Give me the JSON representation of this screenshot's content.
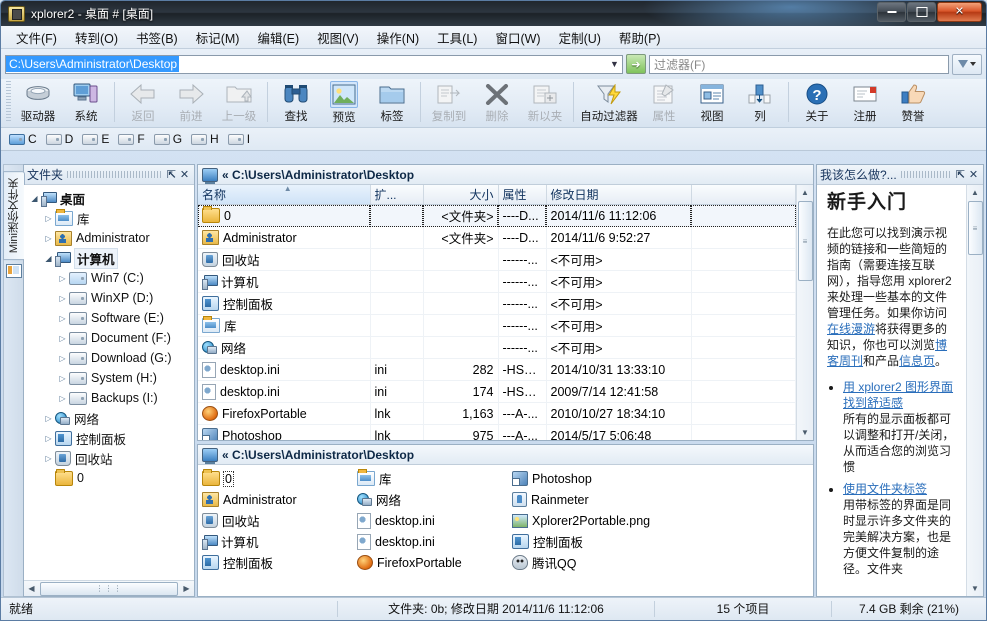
{
  "window": {
    "title": "xplorer2 - 桌面 # [桌面]",
    "minimize_label": "最小化",
    "maximize_label": "最大化",
    "close_label": "✕"
  },
  "menu": {
    "items": [
      "文件(F)",
      "转到(O)",
      "书签(B)",
      "标记(M)",
      "编辑(E)",
      "视图(V)",
      "操作(N)",
      "工具(L)",
      "窗口(W)",
      "定制(U)",
      "帮助(P)"
    ]
  },
  "address": {
    "value": "C:\\Users\\Administrator\\Desktop",
    "dropdown_glyph": "▼",
    "go_glyph": "➜",
    "filter_placeholder": "过滤器(F)",
    "filter_value": ""
  },
  "toolbar": {
    "buttons": [
      {
        "label": "驱动器",
        "icon": "drive-icon",
        "state": "normal"
      },
      {
        "label": "系统",
        "icon": "system-icon",
        "state": "normal"
      },
      {
        "label": "返回",
        "icon": "back-arrow-icon",
        "state": "disabled"
      },
      {
        "label": "前进",
        "icon": "forward-arrow-icon",
        "state": "disabled"
      },
      {
        "label": "上一级",
        "icon": "up-folder-icon",
        "state": "disabled"
      },
      {
        "label": "查找",
        "icon": "binoculars-icon",
        "state": "normal"
      },
      {
        "label": "预览",
        "icon": "preview-image-icon",
        "state": "selected"
      },
      {
        "label": "标签",
        "icon": "folder-tab-icon",
        "state": "normal"
      },
      {
        "label": "复制到",
        "icon": "copy-to-icon",
        "state": "disabled"
      },
      {
        "label": "删除",
        "icon": "delete-x-icon",
        "state": "disabled"
      },
      {
        "label": "新以夹",
        "icon": "new-folder-icon",
        "state": "disabled"
      },
      {
        "label": "自动过滤器",
        "icon": "auto-filter-icon",
        "state": "normal"
      },
      {
        "label": "属性",
        "icon": "properties-icon",
        "state": "disabled"
      },
      {
        "label": "视图",
        "icon": "view-icon",
        "state": "normal"
      },
      {
        "label": "列",
        "icon": "columns-icon",
        "state": "normal"
      },
      {
        "label": "关于",
        "icon": "about-question-icon",
        "state": "normal"
      },
      {
        "label": "注册",
        "icon": "register-envelope-icon",
        "state": "normal"
      },
      {
        "label": "赞誉",
        "icon": "thumbs-up-icon",
        "state": "normal"
      }
    ]
  },
  "drivebar": {
    "drives": [
      {
        "letter": "C",
        "icon": "system-drive-icon"
      },
      {
        "letter": "D",
        "icon": "drive-icon"
      },
      {
        "letter": "E",
        "icon": "drive-icon"
      },
      {
        "letter": "F",
        "icon": "drive-icon"
      },
      {
        "letter": "G",
        "icon": "drive-icon"
      },
      {
        "letter": "H",
        "icon": "drive-icon"
      },
      {
        "letter": "I",
        "icon": "drive-icon"
      }
    ]
  },
  "vertical_tab": {
    "label": "Mini迷你文件夹"
  },
  "tree_panel": {
    "title": "文件夹",
    "pin_glyph": "⇱",
    "close_glyph": "✕",
    "nodes": [
      {
        "label": "桌面",
        "indent": 0,
        "arrow": "open",
        "icon": "desktop-icon",
        "bold": true
      },
      {
        "label": "库",
        "indent": 1,
        "arrow": "closed",
        "icon": "library-icon",
        "bold": false
      },
      {
        "label": "Administrator",
        "indent": 1,
        "arrow": "closed",
        "icon": "user-folder-icon",
        "bold": false
      },
      {
        "label": "计算机",
        "indent": 1,
        "arrow": "open",
        "icon": "computer-icon",
        "bold": true,
        "highlight": true
      },
      {
        "label": "Win7 (C:)",
        "indent": 2,
        "arrow": "closed",
        "icon": "system-drive-icon",
        "bold": false
      },
      {
        "label": "WinXP (D:)",
        "indent": 2,
        "arrow": "closed",
        "icon": "drive-icon",
        "bold": false
      },
      {
        "label": "Software (E:)",
        "indent": 2,
        "arrow": "closed",
        "icon": "drive-icon",
        "bold": false
      },
      {
        "label": "Document (F:)",
        "indent": 2,
        "arrow": "closed",
        "icon": "drive-icon",
        "bold": false
      },
      {
        "label": "Download (G:)",
        "indent": 2,
        "arrow": "closed",
        "icon": "drive-icon",
        "bold": false
      },
      {
        "label": "System (H:)",
        "indent": 2,
        "arrow": "closed",
        "icon": "drive-icon",
        "bold": false
      },
      {
        "label": "Backups (I:)",
        "indent": 2,
        "arrow": "closed",
        "icon": "drive-icon",
        "bold": false
      },
      {
        "label": "网络",
        "indent": 1,
        "arrow": "closed",
        "icon": "network-icon",
        "bold": false
      },
      {
        "label": "控制面板",
        "indent": 1,
        "arrow": "closed",
        "icon": "control-panel-icon",
        "bold": false
      },
      {
        "label": "回收站",
        "indent": 1,
        "arrow": "closed",
        "icon": "recycle-bin-icon",
        "bold": false
      },
      {
        "label": "0",
        "indent": 1,
        "arrow": "none",
        "icon": "folder-icon",
        "bold": false
      }
    ],
    "hscroll": {
      "left_glyph": "◀",
      "right_glyph": "▶",
      "thumb_glyph": "⋮⋮⋮"
    }
  },
  "list_pane": {
    "tab_title": "« C:\\Users\\Administrator\\Desktop",
    "columns": [
      {
        "key": "name",
        "label": "名称",
        "align": "left",
        "sorted": true,
        "sort_glyph": "▲"
      },
      {
        "key": "ext",
        "label": "扩...",
        "align": "left"
      },
      {
        "key": "size",
        "label": "大小",
        "align": "right"
      },
      {
        "key": "attr",
        "label": "属性",
        "align": "left"
      },
      {
        "key": "date",
        "label": "修改日期",
        "align": "left"
      },
      {
        "key": "blank",
        "label": "",
        "align": "left"
      }
    ],
    "rows": [
      {
        "name": "0",
        "icon": "folder-icon",
        "ext": "",
        "size": "<文件夹>",
        "attr": "----D...",
        "date": "2014/11/6 11:12:06",
        "focused": true
      },
      {
        "name": "Administrator",
        "icon": "user-folder-icon",
        "ext": "",
        "size": "<文件夹>",
        "attr": "----D...",
        "date": "2014/11/6 9:52:27"
      },
      {
        "name": "回收站",
        "icon": "recycle-bin-icon",
        "ext": "",
        "size": "",
        "attr": "------...",
        "date": "<不可用>"
      },
      {
        "name": "计算机",
        "icon": "computer-icon",
        "ext": "",
        "size": "",
        "attr": "------...",
        "date": "<不可用>"
      },
      {
        "name": "控制面板",
        "icon": "control-panel-icon",
        "ext": "",
        "size": "",
        "attr": "------...",
        "date": "<不可用>"
      },
      {
        "name": "库",
        "icon": "library-icon",
        "ext": "",
        "size": "",
        "attr": "------...",
        "date": "<不可用>"
      },
      {
        "name": "网络",
        "icon": "network-icon",
        "ext": "",
        "size": "",
        "attr": "------...",
        "date": "<不可用>"
      },
      {
        "name": "desktop.ini",
        "icon": "ini-file-icon",
        "ext": "ini",
        "size": "282",
        "attr": "-HSA...",
        "date": "2014/10/31 13:33:10"
      },
      {
        "name": "desktop.ini",
        "icon": "ini-file-icon",
        "ext": "ini",
        "size": "174",
        "attr": "-HSA...",
        "date": "2009/7/14 12:41:58"
      },
      {
        "name": "FirefoxPortable",
        "icon": "firefox-icon",
        "ext": "lnk",
        "size": "1,163",
        "attr": "---A-...",
        "date": "2010/10/27 18:34:10"
      },
      {
        "name": "Photoshop",
        "icon": "shortcut-icon",
        "ext": "lnk",
        "size": "975",
        "attr": "---A-...",
        "date": "2014/5/17 5:06:48"
      }
    ],
    "scroll": {
      "up_glyph": "▲",
      "down_glyph": "▼",
      "thumb_glyph": "≡"
    }
  },
  "bottom_pane": {
    "tab_title": "« C:\\Users\\Administrator\\Desktop",
    "columns": [
      [
        {
          "name": "0",
          "icon": "folder-icon",
          "focused": true
        },
        {
          "name": "Administrator",
          "icon": "user-folder-icon"
        },
        {
          "name": "回收站",
          "icon": "recycle-bin-icon"
        },
        {
          "name": "计算机",
          "icon": "computer-icon"
        },
        {
          "name": "控制面板",
          "icon": "control-panel-icon"
        }
      ],
      [
        {
          "name": "库",
          "icon": "library-icon"
        },
        {
          "name": "网络",
          "icon": "network-icon"
        },
        {
          "name": "desktop.ini",
          "icon": "ini-file-icon"
        },
        {
          "name": "desktop.ini",
          "icon": "ini-file-icon"
        },
        {
          "name": "FirefoxPortable",
          "icon": "firefox-icon"
        }
      ],
      [
        {
          "name": "Photoshop",
          "icon": "shortcut-icon"
        },
        {
          "name": "Rainmeter",
          "icon": "rainmeter-icon"
        },
        {
          "name": "Xplorer2Portable.png",
          "icon": "png-image-icon"
        },
        {
          "name": "控制面板",
          "icon": "control-panel-icon"
        },
        {
          "name": "腾讯QQ",
          "icon": "qq-icon"
        }
      ]
    ]
  },
  "help_pane": {
    "title": "我该怎么做?...",
    "pin_glyph": "⇱",
    "close_glyph": "✕",
    "heading": "新手入门",
    "paragraph_1a": "在此您可以找到演示视频的链接和一些简短的指南（需要连接互联网），指导您用 xplorer2 来处理一些基本的文件管理任务。如果你访问",
    "link_tour": "在线漫游",
    "paragraph_1b": "将获得更多的知识，你也可以浏览",
    "link_blog": "博客周刊",
    "paragraph_1c": "和产品",
    "link_info": "信息页",
    "paragraph_1d": "。",
    "bullets": [
      {
        "link": "用 xplorer2 图形界面找到舒适感",
        "text": "所有的显示面板都可以调整和打开/关闭，从而适合您的浏览习惯"
      },
      {
        "link": "使用文件夹标签",
        "text": "用带标签的界面是同时显示许多文件夹的完美解决方案，也是方便文件复制的途径。文件夹"
      }
    ],
    "scroll": {
      "up_glyph": "▲",
      "down_glyph": "▼",
      "thumb_glyph": "≡"
    }
  },
  "status_bar": {
    "ready": "就绪",
    "detail": "文件夹: 0b; 修改日期 2014/11/6 11:12:06",
    "count": "15 个项目",
    "free_space": "7.4 GB 剩余 (21%)"
  }
}
